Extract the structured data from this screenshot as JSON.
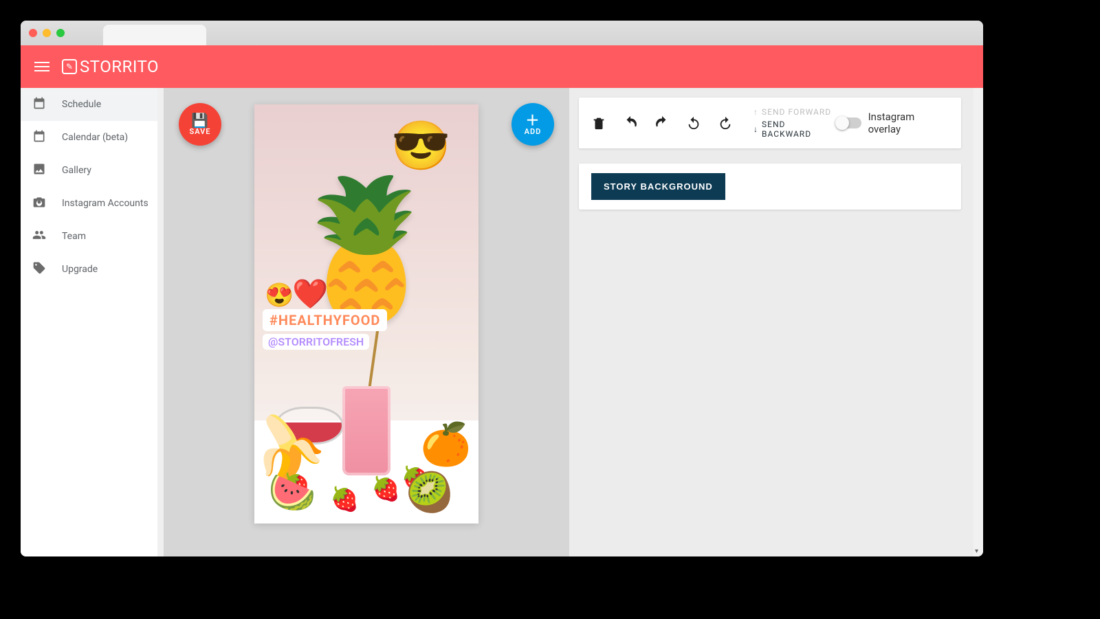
{
  "app": {
    "name": "STORRITO"
  },
  "sidebar": {
    "items": [
      {
        "label": "Schedule"
      },
      {
        "label": "Calendar (beta)"
      },
      {
        "label": "Gallery"
      },
      {
        "label": "Instagram Accounts"
      },
      {
        "label": "Team"
      },
      {
        "label": "Upgrade"
      }
    ]
  },
  "editor": {
    "save_label": "SAVE",
    "add_label": "ADD",
    "hashtag_text": "#HEALTHYFOOD",
    "mention_text": "@STORRITOFRESH"
  },
  "toolbar": {
    "send_forward": "SEND FORWARD",
    "send_backward": "SEND BACKWARD",
    "overlay_label": "Instagram overlay"
  },
  "panel": {
    "story_background": "STORY BACKGROUND"
  }
}
